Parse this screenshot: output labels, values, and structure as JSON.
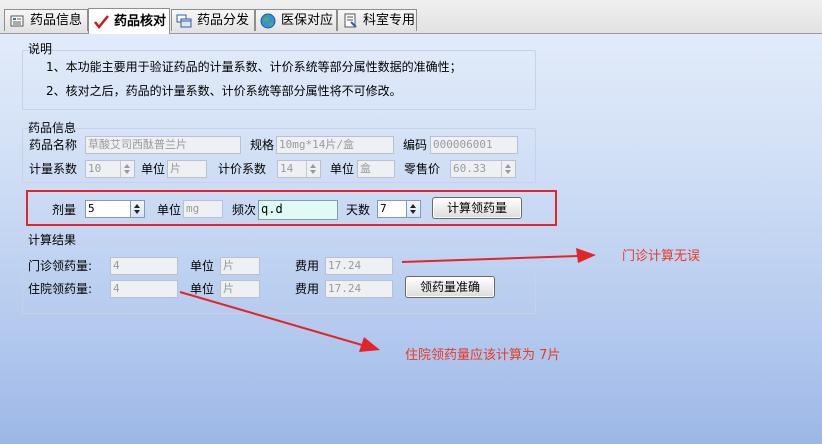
{
  "tabs": [
    {
      "label": "药品信息",
      "icon": "grid-icon"
    },
    {
      "label": "药品核对",
      "icon": "checkmark-icon"
    },
    {
      "label": "药品分发",
      "icon": "windows-icon"
    },
    {
      "label": "医保对应",
      "icon": "globe-icon"
    },
    {
      "label": "科室专用",
      "icon": "document-icon"
    }
  ],
  "description": {
    "title": "说明",
    "line1": "1、本功能主要用于验证药品的计量系数、计价系统等部分属性数据的准确性；",
    "line2": "2、核对之后，药品的计量系数、计价系统等部分属性将不可修改。"
  },
  "drug_info": {
    "title": "药品信息",
    "name_label": "药品名称",
    "name_value": "草酸艾司西酞普兰片",
    "spec_label": "规格",
    "spec_value": "10mg*14片/盒",
    "code_label": "编码",
    "code_value": "000006001",
    "measure_coef_label": "计量系数",
    "measure_coef_value": "10",
    "measure_unit_label": "单位",
    "measure_unit_value": "片",
    "price_coef_label": "计价系数",
    "price_coef_value": "14",
    "price_unit_label": "单位",
    "price_unit_value": "盒",
    "retail_label": "零售价",
    "retail_value": "60.33"
  },
  "dosage": {
    "dose_label": "剂量",
    "dose_value": "5",
    "unit_label": "单位",
    "unit_value": "mg",
    "freq_label": "频次",
    "freq_value": "q.d",
    "days_label": "天数",
    "days_value": "7",
    "calc_button": "计算领药量"
  },
  "result": {
    "title": "计算结果",
    "outpatient_label": "门诊领药量:",
    "outpatient_value": "4",
    "outpatient_unit_label": "单位",
    "outpatient_unit_value": "片",
    "outpatient_fee_label": "费用",
    "outpatient_fee_value": "17.24",
    "inpatient_label": "住院领药量:",
    "inpatient_value": "4",
    "inpatient_unit_label": "单位",
    "inpatient_unit_value": "片",
    "inpatient_fee_label": "费用",
    "inpatient_fee_value": "17.24",
    "confirm_button": "领药量准确"
  },
  "annotations": {
    "outpatient_note": "门诊计算无误",
    "inpatient_note": "住院领药量应该计算为 7片",
    "color": "#e63a2a",
    "box_color": "#e3242b"
  }
}
